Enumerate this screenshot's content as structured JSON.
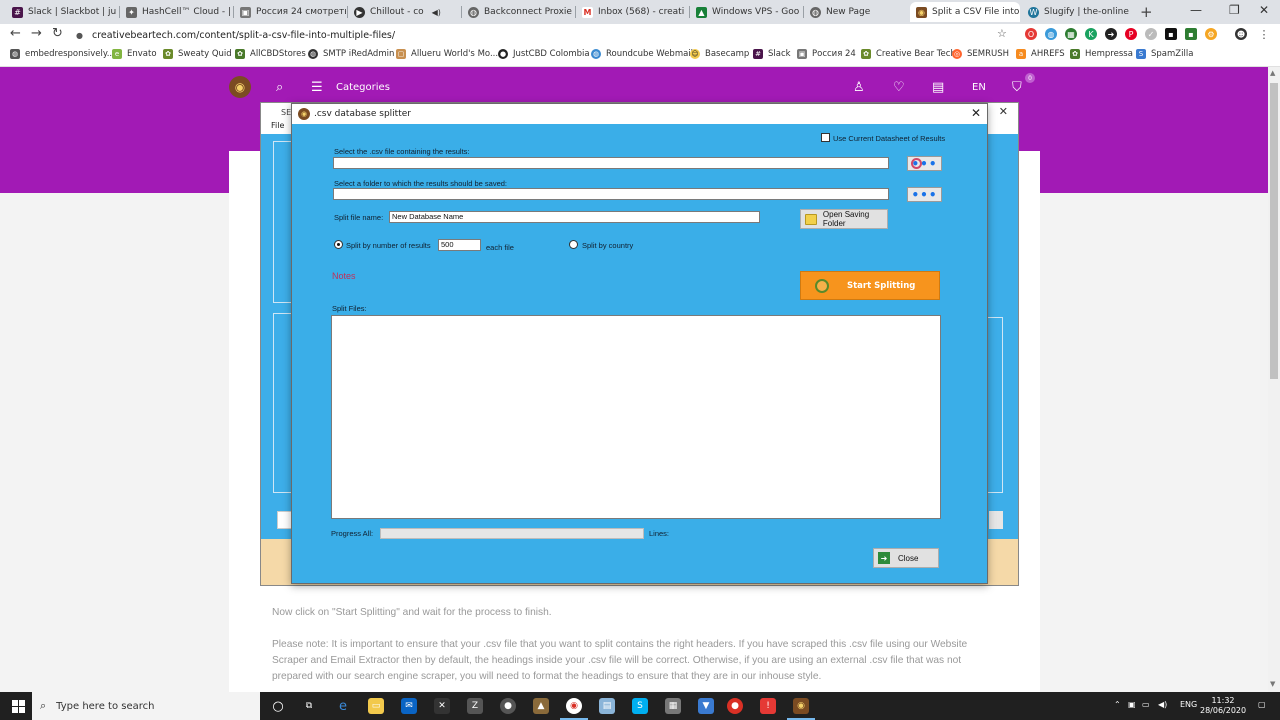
{
  "browser": {
    "tabs": [
      {
        "label": "Slack | Slackbot | ju",
        "icon": "slack-icon",
        "color": "#4a154b"
      },
      {
        "label": "HashCell™ Cloud - |",
        "icon": "hashcell-icon",
        "color": "#555555"
      },
      {
        "label": "Россия 24 смотреть",
        "icon": "tv-icon",
        "color": "#555555"
      },
      {
        "label": "Chillout - co",
        "icon": "youtube-icon",
        "color": "#333333"
      },
      {
        "label": "Backconnect Proxie",
        "icon": "globe-icon",
        "color": "#555555"
      },
      {
        "label": "Inbox (568) - creati",
        "icon": "gmail-icon",
        "color": "#d93025"
      },
      {
        "label": "Windows VPS - Goo",
        "icon": "drive-icon",
        "color": "#188038"
      },
      {
        "label": "New Page",
        "icon": "globe-icon",
        "color": "#555555"
      },
      {
        "label": "Split a CSV File into",
        "icon": "bear-icon",
        "color": "#7b4b22"
      },
      {
        "label": "Slugify | the-online",
        "icon": "wordpress-icon",
        "color": "#21759b"
      }
    ],
    "active_tab": 8,
    "url": "creativebeartech.com/content/split-a-csv-file-into-multiple-files/",
    "bookmarks": [
      {
        "label": "embedresponsively...",
        "color": "#555555"
      },
      {
        "label": "Envato",
        "color": "#82b541"
      },
      {
        "label": "Sweaty Quid",
        "color": "#6a8a2a"
      },
      {
        "label": "AllCBDStores",
        "color": "#4a7a2a"
      },
      {
        "label": "SMTP iRedAdmin",
        "color": "#333333"
      },
      {
        "label": "Allueru World's Mo...",
        "color": "#c89050"
      },
      {
        "label": "JustCBD Colombia",
        "color": "#222222"
      },
      {
        "label": "Roundcube Webmail",
        "color": "#3a8ad0"
      },
      {
        "label": "Basecamp",
        "color": "#f2c94c"
      },
      {
        "label": "Slack",
        "color": "#4a154b"
      },
      {
        "label": "Россия 24",
        "color": "#555555"
      },
      {
        "label": "Creative Bear Tech",
        "color": "#6a8a2a"
      },
      {
        "label": "SEMRUSH",
        "color": "#ff642d"
      },
      {
        "label": "AHREFS",
        "color": "#f68b1f"
      },
      {
        "label": "Hempressa",
        "color": "#4a7a2a"
      },
      {
        "label": "SpamZilla",
        "color": "#3a7ad0"
      }
    ]
  },
  "site": {
    "categories_label": "Categories",
    "lang": "EN",
    "cart_count": "0",
    "paragraph1": "Now click on \"Start Splitting\" and wait for the process to finish.",
    "paragraph2": "Please note: It is important to ensure that your .csv file that you want to split contains the right headers. If you have scraped this .csv file using our Website Scraper and Email Extractor then by default, the headings inside your .csv file will be correct. Otherwise, if you are using an external .csv file that was not prepared with our search engine scraper, you will need to format the headings to ensure that they are in our inhouse style."
  },
  "bg_window": {
    "title": "SE",
    "menu_file": "File"
  },
  "dialog": {
    "title": ".csv database splitter",
    "use_current_label": "Use Current Datasheet of Results",
    "select_csv_label": "Select the .csv file containing the results:",
    "csv_path": "",
    "select_folder_label": "Select a folder to which the results should be saved:",
    "folder_path": "",
    "split_name_label": "Split file name:",
    "split_name_value": "New Database Name",
    "open_folder_label": "Open Saving Folder",
    "split_by_number_label": "Split by number of results",
    "results_per_file": "500",
    "each_file_label": "each file",
    "split_by_country_label": "Split by country",
    "notes_label": "Notes",
    "start_label": "Start Splitting",
    "split_files_label": "Split Files:",
    "progress_label": "Progress All:",
    "lines_label": "Lines:",
    "close_label": "Close",
    "dots": "•••"
  },
  "taskbar": {
    "search_placeholder": "Type here to search",
    "lang": "ENG",
    "time": "11:32",
    "date": "28/06/2020"
  }
}
